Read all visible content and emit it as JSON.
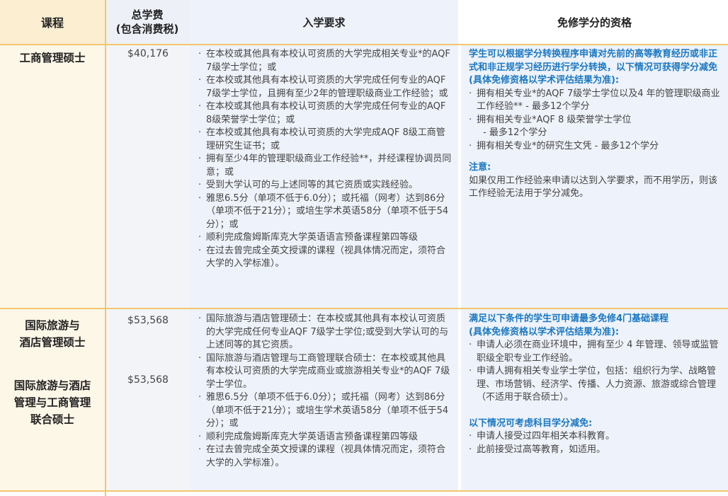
{
  "headers": {
    "course": "课程",
    "fee_line1": "总学费",
    "fee_line2": "(包含消费税)",
    "requirements": "入学要求",
    "credit": "免修学分的资格"
  },
  "rows": {
    "mba": {
      "course": "工商管理硕士",
      "fee": "$40,176",
      "req": [
        "在本校或其他具有本校认可资质的大学完成相关专业*的AQF 7级学士学位；或",
        "在本校或其他具有本校认可资质的大学完成任何专业的AQF 7级学士学位，且拥有至少2年的管理职级商业工作经验；或",
        "在本校或其他具有本校认可资质的大学完成任何专业的AQF 8级荣誉学士学位；或",
        "在本校或其他具有本校认可资质的大学完成AQF 8级工商管理研究生证书；或",
        "拥有至少4年的管理职级商业工作经验**，并经课程协调员同意；或",
        "受到大学认可的与上述同等的其它资质或实践经验。",
        "雅思6.5分（单项不低于6.0分）；或托福（网考）达到86分（单项不低于21分）；或培生学术英语58分（单项不低于54分）；或",
        "顺利完成詹姆斯库克大学英语语言预备课程第四等级",
        "在过去曾完成全英文授课的课程（视具体情况而定，须符合大学的入学标准）。"
      ],
      "credit_title": "学生可以根据学分转换程序申请对先前的高等教育经历或非正式和非正规学习经历进行学分转换，以下情况可获得学分减免",
      "credit_sub": "(具体免修资格以学术评估结果为准):",
      "credit_items": [
        "拥有相关专业*的AQF 7级学士学位以及4 年的管理职级商业工作经验** - 最多12个学分",
        "拥有相关专业*AQF 8 级荣誉学士学位",
        "- 最多12个学分",
        "拥有相关专业*的研究生文凭 - 最多12个学分"
      ],
      "note_title": "注意:",
      "note_text": "如果仅用工作经验来申请以达到入学要求，而不用学历，则该工作经验无法用于学分减免。"
    },
    "ithm": {
      "course_line1": "国际旅游与",
      "course_line2": "酒店管理硕士",
      "fee": "$53,568"
    },
    "ithm_mba": {
      "course_line1": "国际旅游与酒店",
      "course_line2": "管理与工商管理",
      "course_line3": "联合硕士",
      "fee": "$53,568"
    },
    "shared": {
      "req": [
        "国际旅游与酒店管理硕士：在本校或其他具有本校认可资质的大学完成任何专业AQF 7级学士学位;或受到大学认可的与上述同等的其它资质。",
        "国际旅游与酒店管理与工商管理联合硕士：在本校或其他具有本校认可资质的大学完成商业或旅游相关专业*的AQF 7级学士学位。",
        "雅思6.5分（单项不低于6.0分）；或托福（网考）达到86分（单项不低于21分）；或培生学术英语58分（单项不低于54分）；或",
        "顺利完成詹姆斯库克大学英语语言预备课程第四等级",
        "在过去曾完成全英文授课的课程（视具体情况而定，须符合大学的入学标准）。"
      ],
      "credit_title1": "满足以下条件的学生可申请最多免修4门基础课程",
      "credit_title2": "(具体免修资格以学术评估结果为准):",
      "credit_items": [
        "申请人必须在商业环境中，拥有至少 4 年管理、领导或监管职级全职专业工作经验。",
        "申请人拥有相关专业学士学位，包括：组织行为学、战略管理、市场营销、经济学、传播、人力资源、旅游或综合管理 （不适用于联合硕士）。"
      ],
      "credit_title3": "以下情况可考虑科目学分减免:",
      "credit_items2": [
        "申请人接受过四年相关本科教育。",
        "此前接受过高等教育，如适用。"
      ]
    }
  }
}
